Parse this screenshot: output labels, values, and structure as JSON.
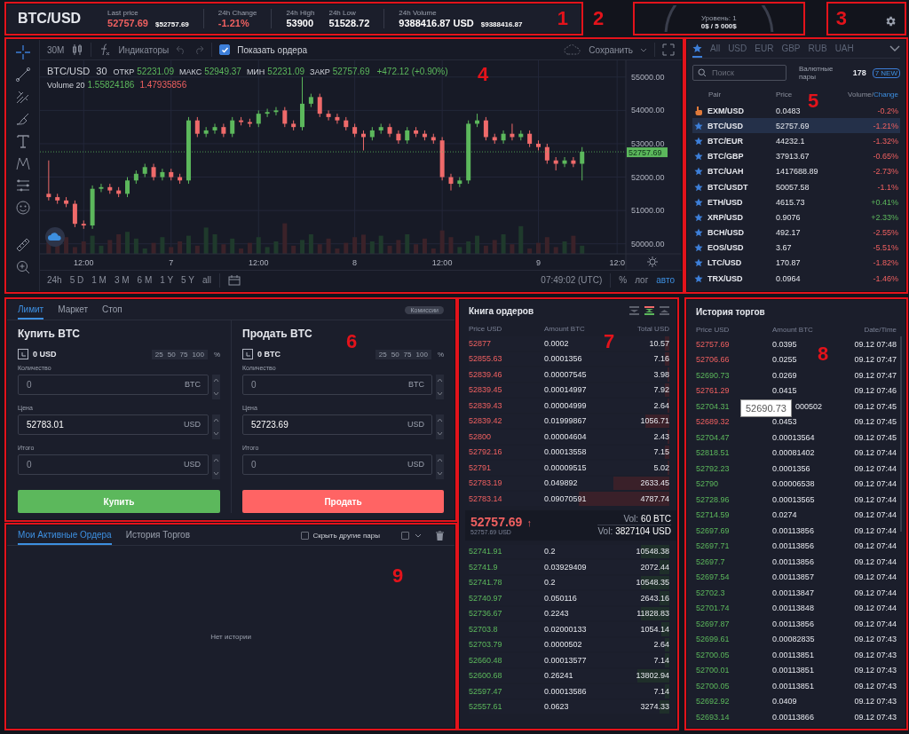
{
  "header": {
    "marker": "1",
    "pair": "BTC/USD",
    "stats": [
      {
        "label": "Last price",
        "value": "52757.69",
        "kind": "down",
        "sub": "$52757.69",
        "divider_before": false
      },
      {
        "label": "24h Change",
        "value": "-1.21%",
        "kind": "down",
        "divider_before": true
      },
      {
        "label": "24h High",
        "value": "53900",
        "kind": "plain",
        "divider_before": true
      },
      {
        "label": "24h Low",
        "value": "51528.72",
        "kind": "plain",
        "divider_before": false
      },
      {
        "label": "24h Volume",
        "value": "9388416.87 USD",
        "kind": "plain",
        "sub": "$9388416.87",
        "divider_before": true
      }
    ]
  },
  "level_panel": {
    "marker": "2",
    "label": "Уровень: 1",
    "value": "0$ / 5 000$"
  },
  "settings_panel": {
    "marker": "3"
  },
  "chart": {
    "marker": "4",
    "interval": "30M",
    "indicators": "Индикаторы",
    "show_orders": {
      "label": "Показать ордера",
      "checked": true
    },
    "save": "Сохранить",
    "legend": {
      "symbol": "BTC/USD",
      "interval": "30",
      "fields": [
        {
          "label": "ОТКР",
          "value": "52231.09"
        },
        {
          "label": "МАКС",
          "value": "52949.37"
        },
        {
          "label": "МИН",
          "value": "52231.09"
        },
        {
          "label": "ЗАКР",
          "value": "52757.69"
        }
      ],
      "change": "+472.12 (+0.90%)"
    },
    "volume": {
      "label": "Volume 20",
      "up": "1.55824186",
      "down": "1.47935856"
    },
    "chart_data": {
      "type": "candlestick",
      "ylim": [
        49700,
        55500
      ],
      "grid": true,
      "categories": [
        null,
        null,
        null,
        null,
        "12:00",
        null,
        null,
        null,
        null,
        null,
        null,
        null,
        null,
        null,
        "7",
        null,
        null,
        null,
        null,
        null,
        null,
        null,
        null,
        null,
        "12:00",
        null,
        null,
        null,
        null,
        null,
        null,
        null,
        null,
        null,
        null,
        "8",
        null,
        null,
        null,
        null,
        null,
        null,
        null,
        null,
        null,
        "12:00",
        null,
        null,
        null,
        null,
        null,
        null,
        null,
        null,
        null,
        null,
        "9",
        null,
        null,
        null,
        null,
        null,
        null,
        null,
        null,
        "12:0"
      ],
      "ohlc": [
        [
          51500,
          52500,
          51300,
          51400
        ],
        [
          51400,
          51500,
          51200,
          51300
        ],
        [
          51300,
          51400,
          51100,
          51200
        ],
        [
          51200,
          51300,
          50500,
          50600
        ],
        [
          50600,
          50700,
          50450,
          50550
        ],
        [
          50550,
          51750,
          50450,
          51650
        ],
        [
          51650,
          51800,
          51550,
          51700
        ],
        [
          51700,
          51800,
          51500,
          51600
        ],
        [
          51600,
          51700,
          51400,
          51500
        ],
        [
          51500,
          52000,
          51400,
          51900
        ],
        [
          51900,
          52200,
          51800,
          52100
        ],
        [
          52100,
          52400,
          52000,
          52300
        ],
        [
          52300,
          52400,
          51900,
          52000
        ],
        [
          52000,
          52250,
          51900,
          52150
        ],
        [
          52150,
          52250,
          51900,
          52000
        ],
        [
          52000,
          52100,
          51800,
          51900
        ],
        [
          51900,
          53800,
          51800,
          53700
        ],
        [
          53700,
          53800,
          53200,
          53300
        ],
        [
          53300,
          53500,
          53200,
          53400
        ],
        [
          53400,
          53600,
          53300,
          53500
        ],
        [
          53500,
          53600,
          53200,
          53300
        ],
        [
          53300,
          53800,
          53200,
          53700
        ],
        [
          53700,
          53800,
          53550,
          53650
        ],
        [
          53650,
          53750,
          53500,
          53600
        ],
        [
          53600,
          54000,
          53500,
          53900
        ],
        [
          53900,
          54050,
          53800,
          53950
        ],
        [
          53950,
          54100,
          53850,
          54000
        ],
        [
          54000,
          54100,
          53500,
          53600
        ],
        [
          53600,
          53700,
          53400,
          53500
        ],
        [
          53500,
          55000,
          53400,
          54200
        ],
        [
          54200,
          54500,
          54100,
          54400
        ],
        [
          54400,
          54500,
          53800,
          53900
        ],
        [
          53900,
          54000,
          53700,
          53800
        ],
        [
          53800,
          53900,
          53600,
          53700
        ],
        [
          53700,
          53800,
          53400,
          53500
        ],
        [
          53500,
          53600,
          53200,
          53300
        ],
        [
          53300,
          53400,
          52800,
          53200
        ],
        [
          53200,
          53500,
          53100,
          53400
        ],
        [
          53400,
          53600,
          53300,
          53500
        ],
        [
          53500,
          53600,
          53200,
          53300
        ],
        [
          53300,
          53400,
          53000,
          53100
        ],
        [
          53100,
          53500,
          53000,
          53400
        ],
        [
          53400,
          53500,
          53200,
          53300
        ],
        [
          53300,
          53400,
          53100,
          53200
        ],
        [
          53200,
          53300,
          53000,
          53100
        ],
        [
          53100,
          53200,
          51900,
          52000
        ],
        [
          52000,
          52100,
          51600,
          51800
        ],
        [
          51800,
          52000,
          51700,
          51900
        ],
        [
          51900,
          53700,
          51800,
          53600
        ],
        [
          53600,
          53900,
          53500,
          53700
        ],
        [
          53700,
          53800,
          53100,
          53200
        ],
        [
          53200,
          53300,
          53000,
          53100
        ],
        [
          53100,
          53400,
          53000,
          53300
        ],
        [
          53300,
          53600,
          53100,
          53200
        ],
        [
          53200,
          53400,
          53100,
          53300
        ],
        [
          53300,
          53400,
          52900,
          53000
        ],
        [
          53000,
          53100,
          52800,
          52900
        ],
        [
          52900,
          53000,
          52400,
          52500
        ],
        [
          52500,
          52600,
          52200,
          52400
        ],
        [
          52400,
          52600,
          52300,
          52500
        ],
        [
          52500,
          52600,
          52300,
          52400
        ],
        [
          52400,
          52900,
          51900,
          52760
        ],
        null,
        null,
        null,
        null
      ],
      "ref_lines": [
        {
          "axis": "y",
          "value": 52757.69,
          "label": "52757.69",
          "color": "#5cb85c"
        }
      ],
      "yticks": [
        {
          "value": 50000,
          "label": "50000.00"
        },
        {
          "value": 51000,
          "label": "51000.00"
        },
        {
          "value": 52000,
          "label": "52000.00"
        },
        {
          "value": 53000,
          "label": "53000.00"
        },
        {
          "value": 54000,
          "label": "54000.00"
        },
        {
          "value": 55000,
          "label": "55000.00"
        }
      ]
    },
    "ranges": [
      "24h",
      "5 D",
      "1 M",
      "3 M",
      "6 M",
      "1 Y",
      "5 Y",
      "all"
    ],
    "time": "07:49:02 (UTC)",
    "scale_options": [
      {
        "label": "%",
        "selected": false
      },
      {
        "label": "лог",
        "selected": false
      },
      {
        "label": "авто",
        "selected": true
      }
    ]
  },
  "pairs": {
    "marker": "5",
    "tabs": [
      {
        "kind": "star",
        "selected": true
      },
      {
        "label": "All",
        "selected": false
      },
      {
        "label": "USD",
        "selected": false
      },
      {
        "label": "EUR",
        "selected": false
      },
      {
        "label": "GBP",
        "selected": false
      },
      {
        "label": "RUB",
        "selected": false
      },
      {
        "label": "UAH",
        "selected": false
      }
    ],
    "search": {
      "placeholder": "Поиск"
    },
    "count_label": "Валютные пары",
    "count": "178",
    "badge": "7 NEW",
    "columns": {
      "pair": "Pair",
      "price": "Price",
      "sort": [
        {
          "label": "Volume/",
          "selected": false
        },
        {
          "label": "Change",
          "selected": true
        }
      ]
    },
    "rows": [
      {
        "kind": "hand",
        "pair": "EXM/USD",
        "price": "0.0483",
        "change": "-0.2%",
        "selected": false
      },
      {
        "kind": "star",
        "pair": "BTC/USD",
        "price": "52757.69",
        "change": "-1.21%",
        "selected": true
      },
      {
        "kind": "star",
        "pair": "BTC/EUR",
        "price": "44232.1",
        "change": "-1.32%",
        "selected": false
      },
      {
        "kind": "star",
        "pair": "BTC/GBP",
        "price": "37913.67",
        "change": "-0.65%",
        "selected": false
      },
      {
        "kind": "star",
        "pair": "BTC/UAH",
        "price": "1417688.89",
        "change": "-2.73%",
        "selected": false
      },
      {
        "kind": "star",
        "pair": "BTC/USDT",
        "price": "50057.58",
        "change": "-1.1%",
        "selected": false
      },
      {
        "kind": "star",
        "pair": "ETH/USD",
        "price": "4615.73",
        "change": "+0.41%",
        "selected": false
      },
      {
        "kind": "star",
        "pair": "XRP/USD",
        "price": "0.9076",
        "change": "+2.33%",
        "selected": false
      },
      {
        "kind": "star",
        "pair": "BCH/USD",
        "price": "492.17",
        "change": "-2.55%",
        "selected": false
      },
      {
        "kind": "star",
        "pair": "EOS/USD",
        "price": "3.67",
        "change": "-5.51%",
        "selected": false
      },
      {
        "kind": "star",
        "pair": "LTC/USD",
        "price": "170.87",
        "change": "-1.82%",
        "selected": false
      },
      {
        "kind": "star",
        "pair": "TRX/USD",
        "price": "0.0964",
        "change": "-1.46%",
        "selected": false
      }
    ]
  },
  "order_form": {
    "marker": "6",
    "tabs": [
      {
        "label": "Лимит",
        "selected": true
      },
      {
        "label": "Маркет",
        "selected": false
      },
      {
        "label": "Стоп",
        "selected": false
      }
    ],
    "fees": "Комиссии",
    "sides": [
      {
        "kind": "buy",
        "title": "Купить BTC",
        "balance": "0 USD",
        "percents": [
          "25",
          "50",
          "75",
          "100"
        ],
        "percent_sign": "%",
        "fields": [
          {
            "label": "Количество",
            "placeholder": "0",
            "unit": "BTC"
          },
          {
            "label": "Цена",
            "value": "52783.01",
            "unit": "USD"
          },
          {
            "label": "Итого",
            "placeholder": "0",
            "unit": "USD"
          }
        ],
        "button": "Купить"
      },
      {
        "kind": "sell",
        "title": "Продать BTC",
        "balance": "0 BTC",
        "percents": [
          "25",
          "50",
          "75",
          "100"
        ],
        "percent_sign": "%",
        "fields": [
          {
            "label": "Количество",
            "placeholder": "0",
            "unit": "BTC"
          },
          {
            "label": "Цена",
            "value": "52723.69",
            "unit": "USD"
          },
          {
            "label": "Итого",
            "placeholder": "0",
            "unit": "USD"
          }
        ],
        "button": "Продать"
      }
    ]
  },
  "orders": {
    "marker": "9",
    "tabs": [
      {
        "label": "Мои Активные Ордера",
        "selected": true
      },
      {
        "label": "История Торгов",
        "selected": false
      }
    ],
    "hide_pairs": {
      "label": "Скрыть другие пары",
      "checked": false
    },
    "select_all": {
      "checked": false
    },
    "empty": "Нет истории"
  },
  "order_book": {
    "marker": "7",
    "title": "Книга ордеров",
    "views": [
      {
        "kind": "asks",
        "selected": false
      },
      {
        "kind": "both",
        "selected": true
      },
      {
        "kind": "bids",
        "selected": false
      }
    ],
    "columns": [
      "Price USD",
      "Amount BTC",
      "Total USD"
    ],
    "asks": [
      {
        "price": "52877",
        "amount": "0.0002",
        "total": "10.57",
        "level": 0.02
      },
      {
        "price": "52855.63",
        "amount": "0.0001356",
        "total": "7.16",
        "level": 0.02
      },
      {
        "price": "52839.46",
        "amount": "0.00007545",
        "total": "3.98",
        "level": 0.01
      },
      {
        "price": "52839.45",
        "amount": "0.00014997",
        "total": "7.92",
        "level": 0.02
      },
      {
        "price": "52839.43",
        "amount": "0.00004999",
        "total": "2.64",
        "level": 0.01
      },
      {
        "price": "52839.42",
        "amount": "0.01999867",
        "total": "1056.71",
        "level": 0.12
      },
      {
        "price": "52800",
        "amount": "0.00004604",
        "total": "2.43",
        "level": 0.01
      },
      {
        "price": "52792.16",
        "amount": "0.00013558",
        "total": "7.15",
        "level": 0.02
      },
      {
        "price": "52791",
        "amount": "0.00009515",
        "total": "5.02",
        "level": 0.01
      },
      {
        "price": "52783.19",
        "amount": "0.049892",
        "total": "2633.45",
        "level": 0.28
      },
      {
        "price": "52783.14",
        "amount": "0.09070591",
        "total": "4787.74",
        "level": 0.45
      }
    ],
    "last": {
      "price": "52757.69",
      "arrow": "↑",
      "sub": "52757.69 USD",
      "vol_btc_label": "Vol:",
      "vol_btc": "60 BTC",
      "vol_usd_label": "Vol:",
      "vol_usd": "3827104 USD"
    },
    "bids": [
      {
        "price": "52741.91",
        "amount": "0.2",
        "total": "10548.38",
        "level": 0.14
      },
      {
        "price": "52741.9",
        "amount": "0.03929409",
        "total": "2072.44",
        "level": 0.05
      },
      {
        "price": "52741.78",
        "amount": "0.2",
        "total": "10548.35",
        "level": 0.14
      },
      {
        "price": "52740.97",
        "amount": "0.050116",
        "total": "2643.16",
        "level": 0.05
      },
      {
        "price": "52736.67",
        "amount": "0.2243",
        "total": "11828.83",
        "level": 0.14
      },
      {
        "price": "52703.8",
        "amount": "0.02000133",
        "total": "1054.14",
        "level": 0.04
      },
      {
        "price": "52703.79",
        "amount": "0.0000502",
        "total": "2.64",
        "level": 0.02
      },
      {
        "price": "52660.48",
        "amount": "0.00013577",
        "total": "7.14",
        "level": 0.02
      },
      {
        "price": "52600.68",
        "amount": "0.26241",
        "total": "13802.94",
        "level": 0.16
      },
      {
        "price": "52597.47",
        "amount": "0.00013586",
        "total": "7.14",
        "level": 0.02
      },
      {
        "price": "52557.61",
        "amount": "0.0623",
        "total": "3274.33",
        "level": 0.05
      }
    ]
  },
  "trade_history": {
    "marker": "8",
    "title": "История торгов",
    "columns": [
      "Price USD",
      "Amount BTC",
      "Date/Time"
    ],
    "tooltip": "52690.73",
    "rows": [
      {
        "kind": "sell",
        "price": "52757.69",
        "amount": "0.0395",
        "time": "09.12 07:48"
      },
      {
        "kind": "sell",
        "price": "52706.66",
        "amount": "0.0255",
        "time": "09.12 07:47"
      },
      {
        "kind": "buy",
        "price": "52690.73",
        "amount": "0.0269",
        "time": "09.12 07:47"
      },
      {
        "kind": "sell",
        "price": "52761.29",
        "amount": "0.0415",
        "time": "09.12 07:46"
      },
      {
        "kind": "buy",
        "price": "52704.31",
        "amount": "000502",
        "time": "09.12 07:45",
        "covered": true
      },
      {
        "kind": "sell",
        "price": "52689.32",
        "amount": "0.0453",
        "time": "09.12 07:45"
      },
      {
        "kind": "buy",
        "price": "52704.47",
        "amount": "0.00013564",
        "time": "09.12 07:45"
      },
      {
        "kind": "buy",
        "price": "52818.51",
        "amount": "0.00081402",
        "time": "09.12 07:44"
      },
      {
        "kind": "buy",
        "price": "52792.23",
        "amount": "0.0001356",
        "time": "09.12 07:44"
      },
      {
        "kind": "buy",
        "price": "52790",
        "amount": "0.00006538",
        "time": "09.12 07:44"
      },
      {
        "kind": "buy",
        "price": "52728.96",
        "amount": "0.00013565",
        "time": "09.12 07:44"
      },
      {
        "kind": "buy",
        "price": "52714.59",
        "amount": "0.0274",
        "time": "09.12 07:44"
      },
      {
        "kind": "buy",
        "price": "52697.69",
        "amount": "0.00113856",
        "time": "09.12 07:44"
      },
      {
        "kind": "buy",
        "price": "52697.71",
        "amount": "0.00113856",
        "time": "09.12 07:44"
      },
      {
        "kind": "buy",
        "price": "52697.7",
        "amount": "0.00113856",
        "time": "09.12 07:44"
      },
      {
        "kind": "buy",
        "price": "52697.54",
        "amount": "0.00113857",
        "time": "09.12 07:44"
      },
      {
        "kind": "buy",
        "price": "52702.3",
        "amount": "0.00113847",
        "time": "09.12 07:44"
      },
      {
        "kind": "buy",
        "price": "52701.74",
        "amount": "0.00113848",
        "time": "09.12 07:44"
      },
      {
        "kind": "buy",
        "price": "52697.87",
        "amount": "0.00113856",
        "time": "09.12 07:44"
      },
      {
        "kind": "buy",
        "price": "52699.61",
        "amount": "0.00082835",
        "time": "09.12 07:43"
      },
      {
        "kind": "buy",
        "price": "52700.05",
        "amount": "0.00113851",
        "time": "09.12 07:43"
      },
      {
        "kind": "buy",
        "price": "52700.01",
        "amount": "0.00113851",
        "time": "09.12 07:43"
      },
      {
        "kind": "buy",
        "price": "52700.05",
        "amount": "0.00113851",
        "time": "09.12 07:43"
      },
      {
        "kind": "buy",
        "price": "52692.92",
        "amount": "0.0409",
        "time": "09.12 07:43"
      },
      {
        "kind": "buy",
        "price": "52693.14",
        "amount": "0.00113866",
        "time": "09.12 07:43"
      }
    ]
  }
}
